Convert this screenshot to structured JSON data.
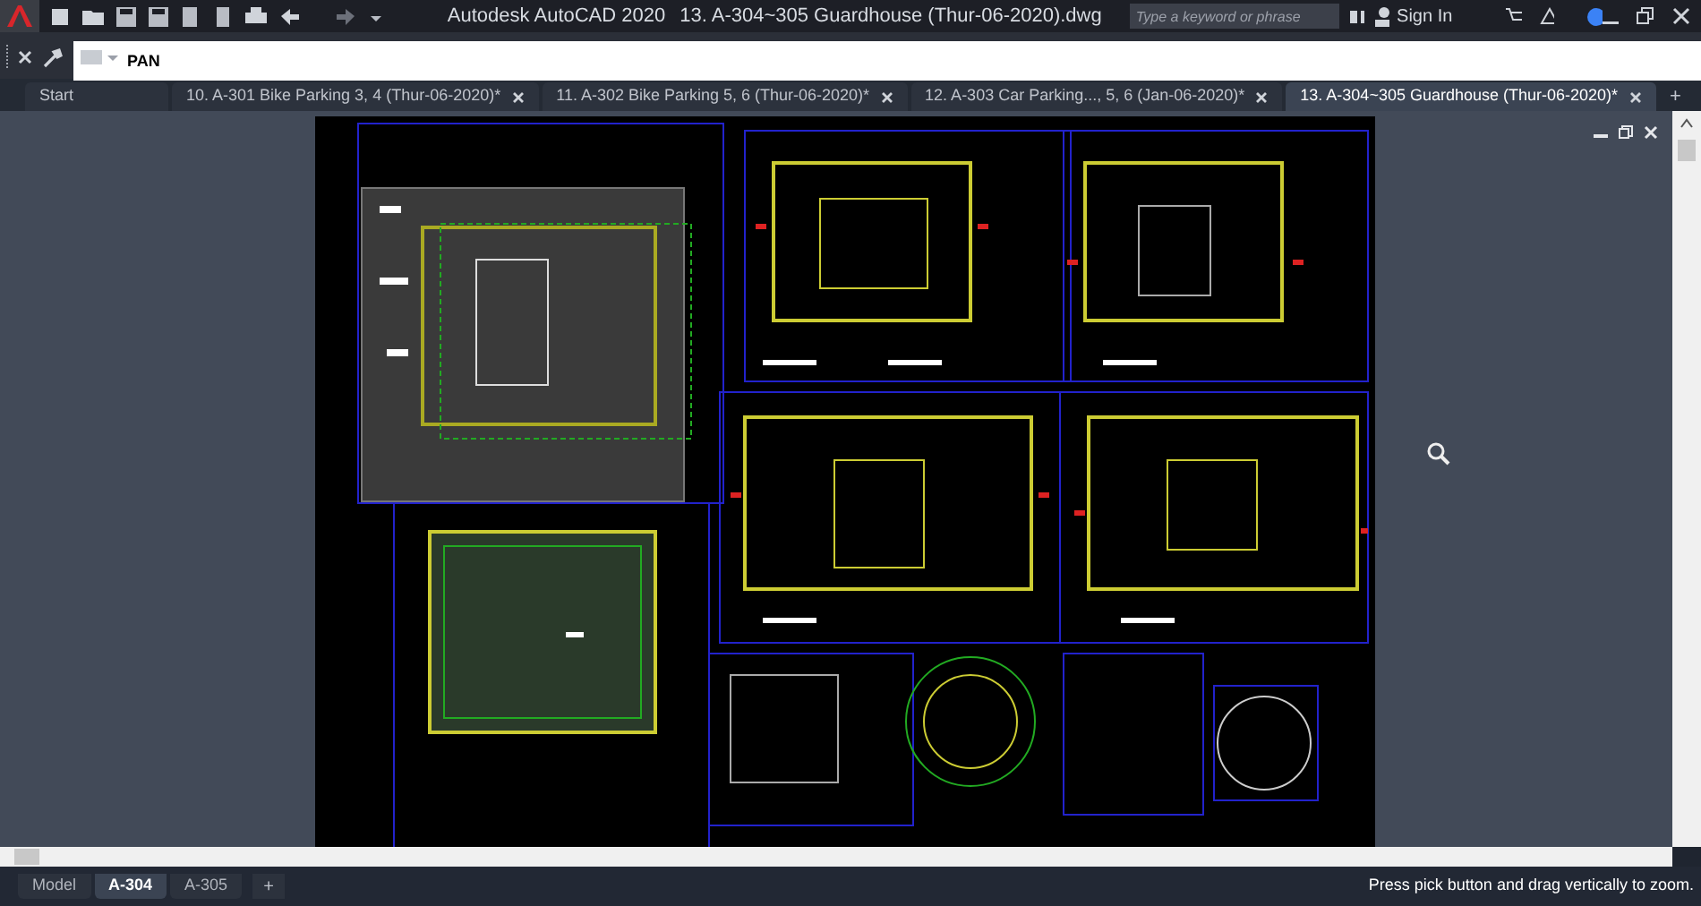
{
  "title_bar": {
    "app_title": "Autodesk AutoCAD 2020",
    "document_title": "13. A-304~305 Guardhouse (Thur-06-2020).dwg",
    "search": {
      "placeholder": "Type a keyword or phrase"
    },
    "sign_in": "Sign In"
  },
  "command_line": {
    "value": "PAN"
  },
  "file_tabs": [
    {
      "label": "Start",
      "selected": false,
      "closable": false
    },
    {
      "label": "10. A-301 Bike Parking 3, 4 (Thur-06-2020)*",
      "selected": false,
      "closable": true
    },
    {
      "label": "11. A-302 Bike Parking 5, 6 (Thur-06-2020)*",
      "selected": false,
      "closable": true
    },
    {
      "label": "12. A-303 Car Parking..., 5, 6 (Jan-06-2020)*",
      "selected": false,
      "closable": true
    },
    {
      "label": "13. A-304~305 Guardhouse (Thur-06-2020)*",
      "selected": true,
      "closable": true
    }
  ],
  "new_tab": "+",
  "layout_tabs": [
    {
      "label": "Model",
      "selected": false
    },
    {
      "label": "A-304",
      "selected": true
    },
    {
      "label": "A-305",
      "selected": false
    }
  ],
  "new_layout": "+",
  "status_bar": {
    "prompt": "Press pick button and drag vertically to zoom."
  }
}
